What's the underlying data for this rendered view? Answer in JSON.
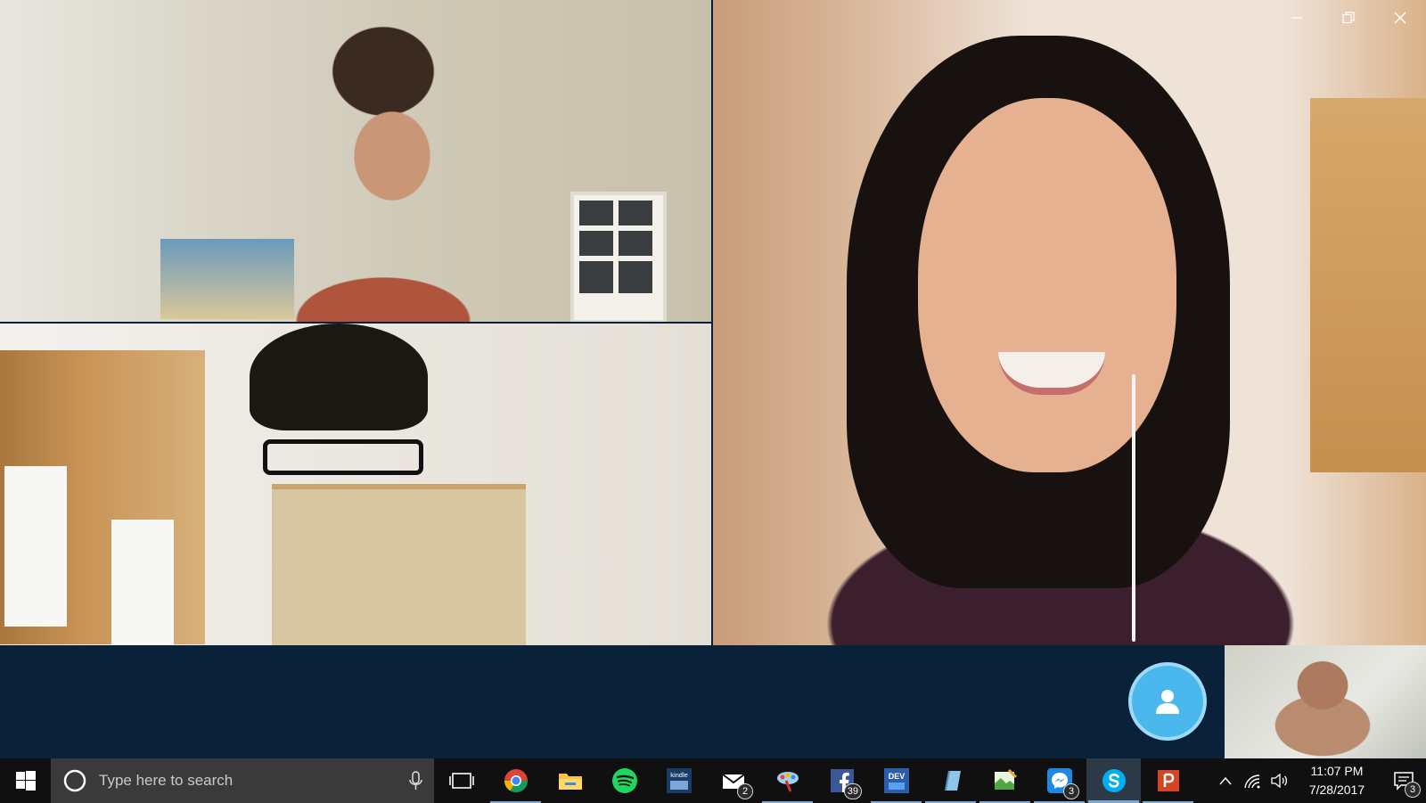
{
  "window": {
    "controls": {
      "minimize": "minimize",
      "restore": "restore",
      "close": "close"
    }
  },
  "call": {
    "accent_color": "#4ab8ec",
    "bar_color": "#0a2239",
    "avatar_icon": "person-icon"
  },
  "taskbar": {
    "search_placeholder": "Type here to search",
    "apps": [
      {
        "name": "chrome",
        "icon": "chrome-icon",
        "badge": "",
        "state": "running"
      },
      {
        "name": "file-explorer",
        "icon": "folder-icon",
        "badge": "",
        "state": ""
      },
      {
        "name": "spotify",
        "icon": "spotify-icon",
        "badge": "",
        "state": ""
      },
      {
        "name": "kindle",
        "icon": "kindle-icon",
        "label": "kindle",
        "badge": "",
        "state": ""
      },
      {
        "name": "mail",
        "icon": "mail-icon",
        "badge": "2",
        "state": ""
      },
      {
        "name": "paint",
        "icon": "paint-icon",
        "badge": "",
        "state": "running"
      },
      {
        "name": "facebook",
        "icon": "facebook-icon",
        "badge": "39",
        "state": ""
      },
      {
        "name": "dev-essentials",
        "icon": "dev-icon",
        "label": "DEV",
        "badge": "",
        "state": "running"
      },
      {
        "name": "notes",
        "icon": "notes-icon",
        "badge": "",
        "state": "running"
      },
      {
        "name": "paint-3d",
        "icon": "paint3d-icon",
        "badge": "",
        "state": "running"
      },
      {
        "name": "messenger",
        "icon": "messenger-icon",
        "badge": "3",
        "state": "running"
      },
      {
        "name": "skype",
        "icon": "skype-icon",
        "badge": "",
        "state": "active"
      },
      {
        "name": "powerpoint",
        "icon": "powerpoint-icon",
        "badge": "",
        "state": "running"
      }
    ],
    "clock": {
      "time": "11:07 PM",
      "date": "7/28/2017"
    },
    "notifications_badge": "3"
  }
}
